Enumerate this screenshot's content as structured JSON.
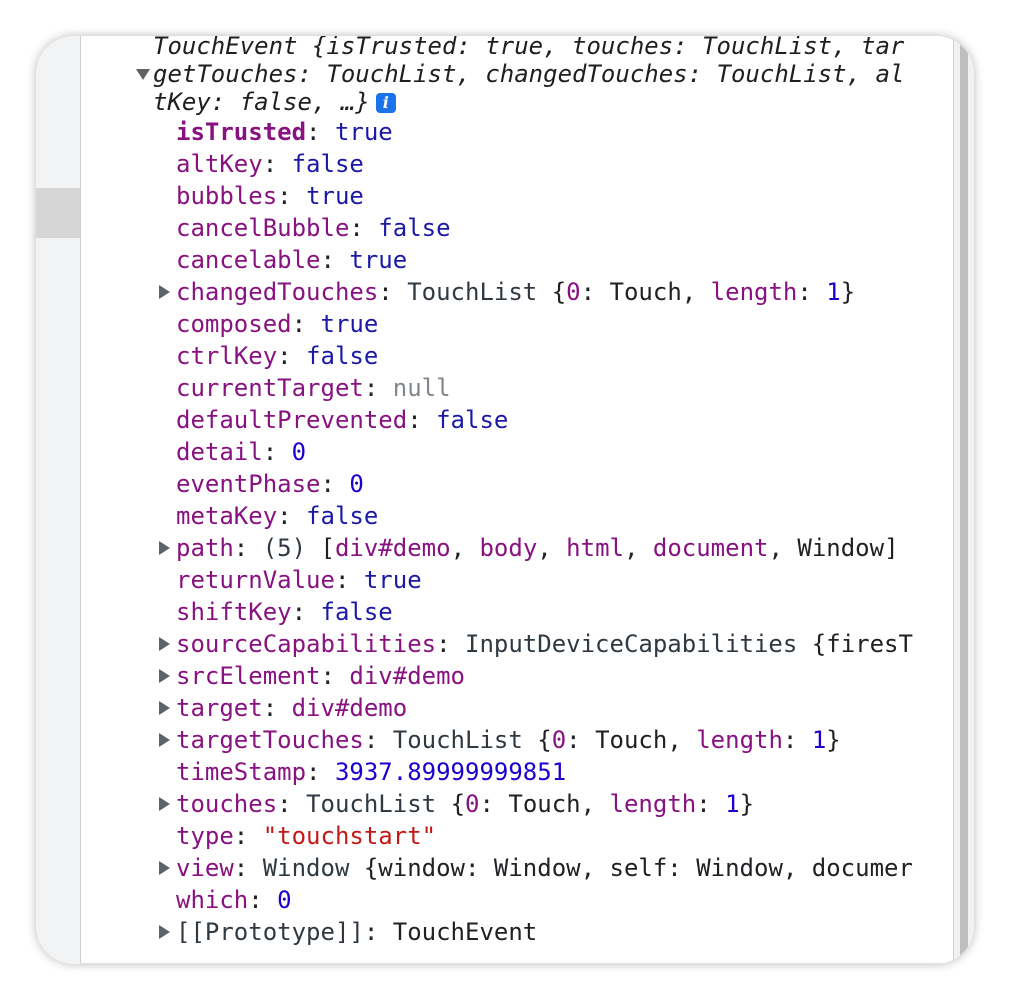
{
  "header": {
    "line1": "TouchEvent {isTrusted: true, touches: TouchList, tar",
    "line2": "getTouches: TouchList, changedTouches: TouchList, al",
    "line3": "tKey: false, …}",
    "info_icon_glyph": "i"
  },
  "props": {
    "isTrusted": {
      "key": "isTrusted",
      "val": "true"
    },
    "altKey": {
      "key": "altKey",
      "val": "false"
    },
    "bubbles": {
      "key": "bubbles",
      "val": "true"
    },
    "cancelBubble": {
      "key": "cancelBubble",
      "val": "false"
    },
    "cancelable": {
      "key": "cancelable",
      "val": "true"
    },
    "changedTouches": {
      "key": "changedTouches",
      "cls": "TouchList",
      "open": "{",
      "zero": "0",
      "touch": "Touch",
      "len_key": "length",
      "len_val": "1",
      "close": "}"
    },
    "composed": {
      "key": "composed",
      "val": "true"
    },
    "ctrlKey": {
      "key": "ctrlKey",
      "val": "false"
    },
    "currentTarget": {
      "key": "currentTarget",
      "val": "null"
    },
    "defaultPrevented": {
      "key": "defaultPrevented",
      "val": "false"
    },
    "detail": {
      "key": "detail",
      "val": "0"
    },
    "eventPhase": {
      "key": "eventPhase",
      "val": "0"
    },
    "metaKey": {
      "key": "metaKey",
      "val": "false"
    },
    "path": {
      "key": "path",
      "count": "(5)",
      "items": [
        "div#demo",
        "body",
        "html",
        "document",
        "Window"
      ]
    },
    "returnValue": {
      "key": "returnValue",
      "val": "true"
    },
    "shiftKey": {
      "key": "shiftKey",
      "val": "false"
    },
    "sourceCapabilities": {
      "key": "sourceCapabilities",
      "cls": "InputDeviceCapabilities",
      "rest": "{firesT"
    },
    "srcElement": {
      "key": "srcElement",
      "val": "div#demo"
    },
    "target": {
      "key": "target",
      "val": "div#demo"
    },
    "targetTouches": {
      "key": "targetTouches",
      "cls": "TouchList",
      "open": "{",
      "zero": "0",
      "touch": "Touch",
      "len_key": "length",
      "len_val": "1",
      "close": "}"
    },
    "timeStamp": {
      "key": "timeStamp",
      "val": "3937.89999999851"
    },
    "touches": {
      "key": "touches",
      "cls": "TouchList",
      "open": "{",
      "zero": "0",
      "touch": "Touch",
      "len_key": "length",
      "len_val": "1",
      "close": "}"
    },
    "type": {
      "key": "type",
      "val": "\"touchstart\""
    },
    "view": {
      "key": "view",
      "cls": "Window",
      "rest": "{window: Window, self: Window, documer"
    },
    "which": {
      "key": "which",
      "val": "0"
    },
    "prototype": {
      "key": "[[Prototype]]",
      "val": "TouchEvent"
    }
  }
}
